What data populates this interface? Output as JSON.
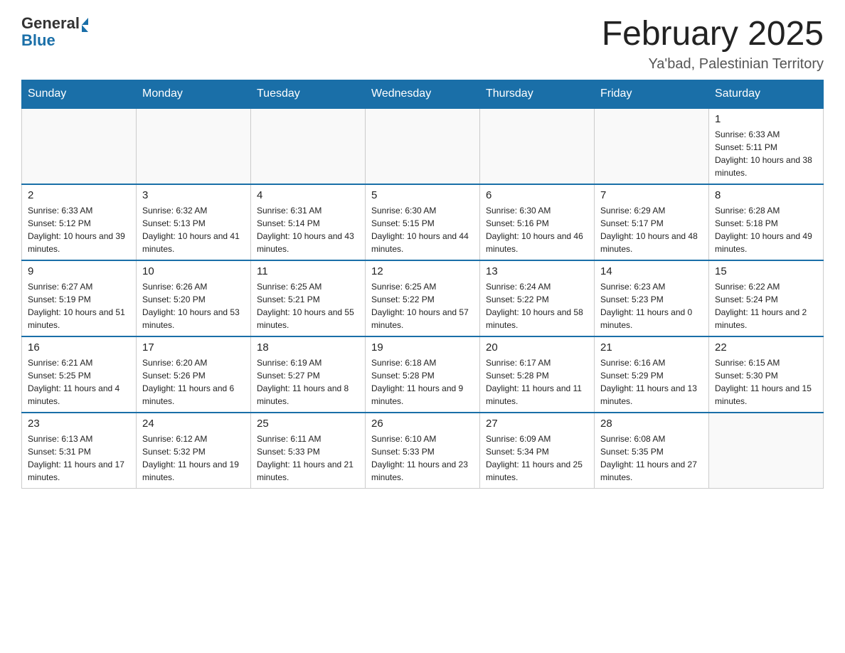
{
  "header": {
    "logo_general": "General",
    "logo_blue": "Blue",
    "month_title": "February 2025",
    "subtitle": "Ya'bad, Palestinian Territory"
  },
  "weekdays": [
    "Sunday",
    "Monday",
    "Tuesday",
    "Wednesday",
    "Thursday",
    "Friday",
    "Saturday"
  ],
  "weeks": [
    {
      "days": [
        {
          "number": "",
          "info": ""
        },
        {
          "number": "",
          "info": ""
        },
        {
          "number": "",
          "info": ""
        },
        {
          "number": "",
          "info": ""
        },
        {
          "number": "",
          "info": ""
        },
        {
          "number": "",
          "info": ""
        },
        {
          "number": "1",
          "info": "Sunrise: 6:33 AM\nSunset: 5:11 PM\nDaylight: 10 hours and 38 minutes."
        }
      ]
    },
    {
      "days": [
        {
          "number": "2",
          "info": "Sunrise: 6:33 AM\nSunset: 5:12 PM\nDaylight: 10 hours and 39 minutes."
        },
        {
          "number": "3",
          "info": "Sunrise: 6:32 AM\nSunset: 5:13 PM\nDaylight: 10 hours and 41 minutes."
        },
        {
          "number": "4",
          "info": "Sunrise: 6:31 AM\nSunset: 5:14 PM\nDaylight: 10 hours and 43 minutes."
        },
        {
          "number": "5",
          "info": "Sunrise: 6:30 AM\nSunset: 5:15 PM\nDaylight: 10 hours and 44 minutes."
        },
        {
          "number": "6",
          "info": "Sunrise: 6:30 AM\nSunset: 5:16 PM\nDaylight: 10 hours and 46 minutes."
        },
        {
          "number": "7",
          "info": "Sunrise: 6:29 AM\nSunset: 5:17 PM\nDaylight: 10 hours and 48 minutes."
        },
        {
          "number": "8",
          "info": "Sunrise: 6:28 AM\nSunset: 5:18 PM\nDaylight: 10 hours and 49 minutes."
        }
      ]
    },
    {
      "days": [
        {
          "number": "9",
          "info": "Sunrise: 6:27 AM\nSunset: 5:19 PM\nDaylight: 10 hours and 51 minutes."
        },
        {
          "number": "10",
          "info": "Sunrise: 6:26 AM\nSunset: 5:20 PM\nDaylight: 10 hours and 53 minutes."
        },
        {
          "number": "11",
          "info": "Sunrise: 6:25 AM\nSunset: 5:21 PM\nDaylight: 10 hours and 55 minutes."
        },
        {
          "number": "12",
          "info": "Sunrise: 6:25 AM\nSunset: 5:22 PM\nDaylight: 10 hours and 57 minutes."
        },
        {
          "number": "13",
          "info": "Sunrise: 6:24 AM\nSunset: 5:22 PM\nDaylight: 10 hours and 58 minutes."
        },
        {
          "number": "14",
          "info": "Sunrise: 6:23 AM\nSunset: 5:23 PM\nDaylight: 11 hours and 0 minutes."
        },
        {
          "number": "15",
          "info": "Sunrise: 6:22 AM\nSunset: 5:24 PM\nDaylight: 11 hours and 2 minutes."
        }
      ]
    },
    {
      "days": [
        {
          "number": "16",
          "info": "Sunrise: 6:21 AM\nSunset: 5:25 PM\nDaylight: 11 hours and 4 minutes."
        },
        {
          "number": "17",
          "info": "Sunrise: 6:20 AM\nSunset: 5:26 PM\nDaylight: 11 hours and 6 minutes."
        },
        {
          "number": "18",
          "info": "Sunrise: 6:19 AM\nSunset: 5:27 PM\nDaylight: 11 hours and 8 minutes."
        },
        {
          "number": "19",
          "info": "Sunrise: 6:18 AM\nSunset: 5:28 PM\nDaylight: 11 hours and 9 minutes."
        },
        {
          "number": "20",
          "info": "Sunrise: 6:17 AM\nSunset: 5:28 PM\nDaylight: 11 hours and 11 minutes."
        },
        {
          "number": "21",
          "info": "Sunrise: 6:16 AM\nSunset: 5:29 PM\nDaylight: 11 hours and 13 minutes."
        },
        {
          "number": "22",
          "info": "Sunrise: 6:15 AM\nSunset: 5:30 PM\nDaylight: 11 hours and 15 minutes."
        }
      ]
    },
    {
      "days": [
        {
          "number": "23",
          "info": "Sunrise: 6:13 AM\nSunset: 5:31 PM\nDaylight: 11 hours and 17 minutes."
        },
        {
          "number": "24",
          "info": "Sunrise: 6:12 AM\nSunset: 5:32 PM\nDaylight: 11 hours and 19 minutes."
        },
        {
          "number": "25",
          "info": "Sunrise: 6:11 AM\nSunset: 5:33 PM\nDaylight: 11 hours and 21 minutes."
        },
        {
          "number": "26",
          "info": "Sunrise: 6:10 AM\nSunset: 5:33 PM\nDaylight: 11 hours and 23 minutes."
        },
        {
          "number": "27",
          "info": "Sunrise: 6:09 AM\nSunset: 5:34 PM\nDaylight: 11 hours and 25 minutes."
        },
        {
          "number": "28",
          "info": "Sunrise: 6:08 AM\nSunset: 5:35 PM\nDaylight: 11 hours and 27 minutes."
        },
        {
          "number": "",
          "info": ""
        }
      ]
    }
  ]
}
